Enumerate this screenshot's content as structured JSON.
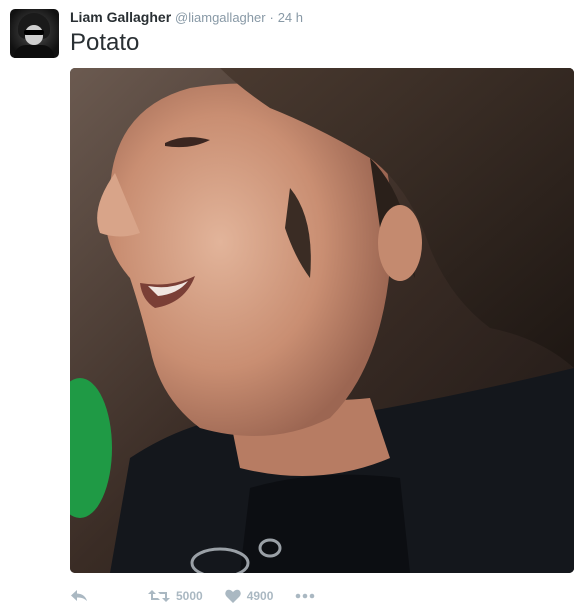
{
  "tweet": {
    "author_name": "Liam Gallagher",
    "handle": "@liamgallagher",
    "separator": "·",
    "time": "24 h",
    "text": "Potato"
  },
  "media": {
    "description_icon": "photo"
  },
  "actions": {
    "reply_icon": "reply-icon",
    "retweet_icon": "retweet-icon",
    "retweet_count": "5000",
    "like_icon": "heart-icon",
    "like_count": "4900",
    "more_icon": "more-icon"
  },
  "colors": {
    "name": "#292f33",
    "meta": "#8899a6",
    "action_gray": "#aab8c2"
  }
}
